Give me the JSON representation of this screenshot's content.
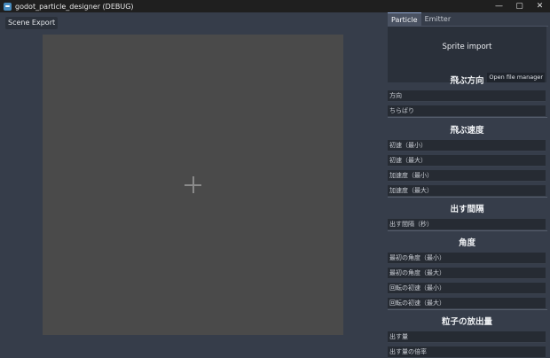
{
  "window": {
    "title": "godot_particle_designer (DEBUG)",
    "controls": [
      "—",
      "▢",
      "✕"
    ]
  },
  "toolbar": {
    "scene_export": "Scene Export"
  },
  "panel": {
    "tabs": [
      {
        "label": "Particle",
        "active": true
      },
      {
        "label": "Emitter",
        "active": false
      }
    ],
    "sprite": {
      "title": "Sprite import",
      "open_button": "Open file manager"
    },
    "sections": [
      {
        "title": "飛ぶ方向",
        "fields": [
          "方向",
          "ちらばり"
        ]
      },
      {
        "title": "飛ぶ速度",
        "fields": [
          "初速（最小）",
          "初速（最大）",
          "加速度（最小）",
          "加速度（最大）"
        ]
      },
      {
        "title": "出す間隔",
        "fields": [
          "出す間隔（秒）"
        ]
      },
      {
        "title": "角度",
        "fields": [
          "最初の角度（最小）",
          "最初の角度（最大）",
          "回転の初速（最小）",
          "回転の初速（最大）"
        ]
      },
      {
        "title": "粒子の放出量",
        "fields": [
          "出す量",
          "出す量の倍率"
        ]
      }
    ]
  },
  "colors": {
    "background": "#363d4a",
    "canvas": "#4a4a4a",
    "titlebar": "#1f1f1f",
    "field": "#262b33"
  }
}
